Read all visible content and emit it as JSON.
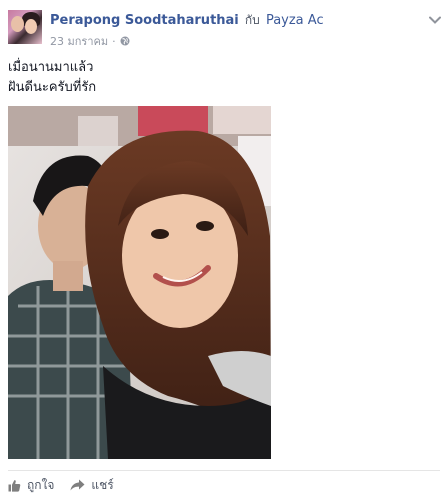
{
  "post": {
    "author": "Perapong Soodtaharuthai",
    "with_word": "กับ",
    "tagged": "Payza Ac",
    "date": "23 มกราคม",
    "date_separator": "·",
    "message_lines": [
      "เมื่อนานมาแล้ว",
      "ฝันดีนะครับที่รัก"
    ]
  },
  "actions": {
    "like_label": "ถูกใจ",
    "share_label": "แชร์"
  },
  "icons": {
    "privacy": "globe-icon",
    "menu": "chevron-down-icon",
    "like": "thumbs-up-icon",
    "share": "share-arrow-icon"
  },
  "colors": {
    "link": "#3b5998",
    "meta": "#9197a3",
    "action": "#4e5665"
  }
}
